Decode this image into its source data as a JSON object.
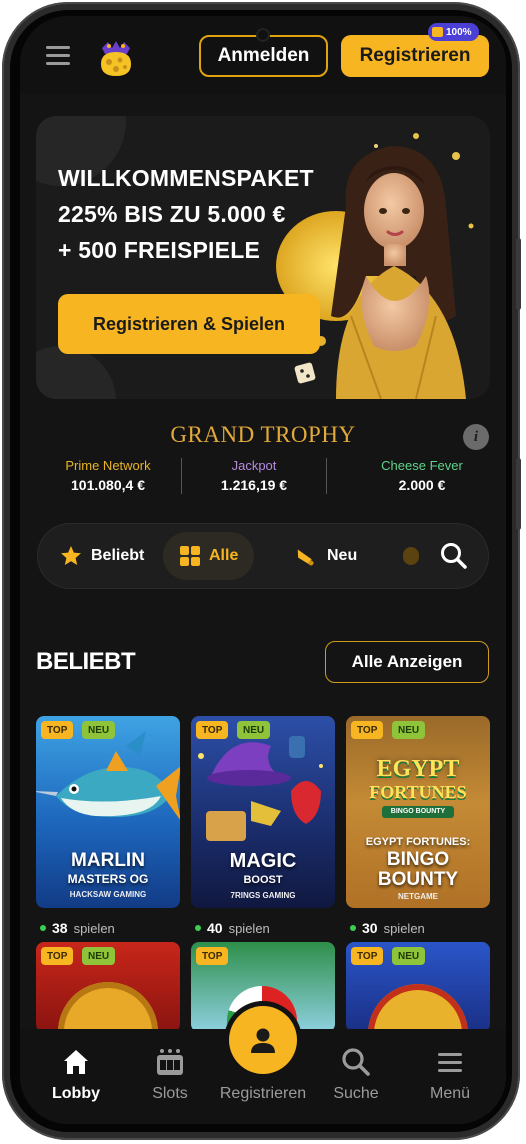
{
  "header": {
    "login_label": "Anmelden",
    "register_label": "Registrieren",
    "badge_text": "100%"
  },
  "hero": {
    "title_line1": "WILLKOMMENSPAKET",
    "title_line2": "225% BIS ZU 5.000 €",
    "title_line3": "+ 500 FREISPIELE",
    "cta_label": "Registrieren & Spielen"
  },
  "jackpots": {
    "title": "GRAND TROPHY",
    "items": [
      {
        "name": "Prime Network",
        "value": "101.080,4 €",
        "color": "#e8b425"
      },
      {
        "name": "Jackpot",
        "value": "1.216,19 €",
        "color": "#b58be0"
      },
      {
        "name": "Cheese Fever",
        "value": "2.000 €",
        "color": "#5fd38a"
      }
    ]
  },
  "categories": [
    {
      "label": "Beliebt",
      "icon": "star-icon"
    },
    {
      "label": "Alle",
      "icon": "grid-icon",
      "active": true
    },
    {
      "label": "Neu",
      "icon": "bell-icon"
    }
  ],
  "section": {
    "title": "BELIEBT",
    "show_all_label": "Alle Anzeigen"
  },
  "games": [
    {
      "title": "MARLIN",
      "title2": "MASTERS OG",
      "provider": "HACKSAW GAMING",
      "tags": [
        "TOP",
        "NEU"
      ],
      "plays": "38",
      "plays_label": "spielen"
    },
    {
      "title": "MAGIC",
      "title2": "BOOST",
      "provider": "7RINGS GAMING",
      "tags": [
        "TOP",
        "NEU"
      ],
      "plays": "40",
      "plays_label": "spielen"
    },
    {
      "title": "EGYPT",
      "title2": "FORTUNES",
      "logo_sub": "BINGO BOUNTY",
      "card_text1": "EGYPT FORTUNES:",
      "card_text2": "BINGO",
      "card_text3": "BOUNTY",
      "provider": "NETGAME",
      "tags": [
        "TOP",
        "NEU"
      ],
      "plays": "30",
      "plays_label": "spielen"
    }
  ],
  "games_row2_tags": [
    [
      "TOP",
      "NEU"
    ],
    [
      "TOP"
    ],
    [
      "TOP",
      "NEU"
    ]
  ],
  "bottom_nav": [
    {
      "label": "Lobby",
      "icon": "home-icon",
      "active": true
    },
    {
      "label": "Slots",
      "icon": "slots-icon"
    },
    {
      "label": "Registrieren",
      "icon": "user-icon"
    },
    {
      "label": "Suche",
      "icon": "search-icon"
    },
    {
      "label": "Menü",
      "icon": "menu-icon"
    }
  ]
}
